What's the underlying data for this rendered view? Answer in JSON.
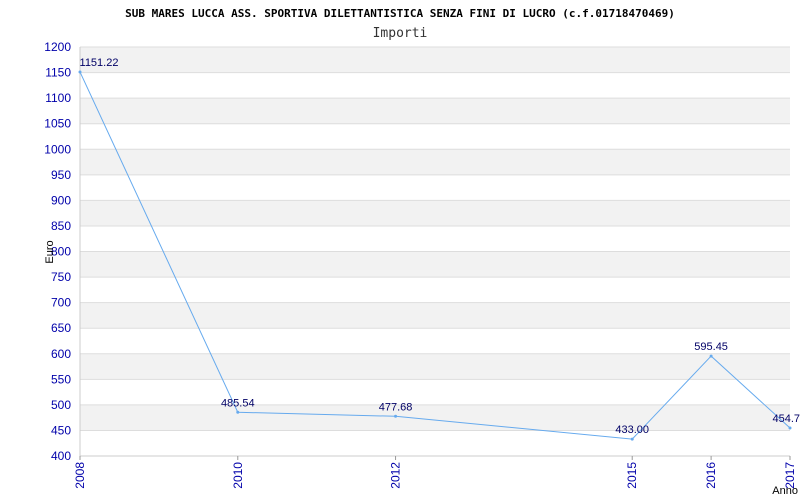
{
  "chart_data": {
    "type": "line",
    "title": "SUB MARES LUCCA ASS. SPORTIVA DILETTANTISTICA SENZA FINI DI LUCRO (c.f.01718470469)",
    "subtitle": "Importi",
    "xlabel": "Anno",
    "ylabel": "Euro",
    "ylim": [
      400,
      1200
    ],
    "yticks": [
      400,
      450,
      500,
      550,
      600,
      650,
      700,
      750,
      800,
      850,
      900,
      950,
      1000,
      1050,
      1100,
      1150,
      1200
    ],
    "x": [
      "2008",
      "2010",
      "2012",
      "2015",
      "2016",
      "2017"
    ],
    "series": [
      {
        "values": [
          1151.22,
          485.54,
          477.68,
          433.0,
          595.45,
          454.7
        ],
        "labels": [
          "1151.22",
          "485.54",
          "477.68",
          "433.00",
          "595.45",
          "454.7"
        ]
      }
    ],
    "grid": true,
    "colors": {
      "line": "#66aaee",
      "band": "#f2f2f2",
      "tick_text": "#0000aa",
      "label_text": "#000066"
    }
  }
}
